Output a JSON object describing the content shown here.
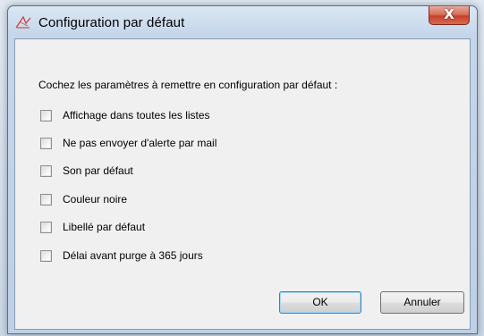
{
  "dialog": {
    "title": "Configuration par défaut",
    "close_label": "X",
    "instruction": "Cochez les paramètres à remettre en configuration par défaut :",
    "options": [
      {
        "label": "Affichage dans toutes les listes",
        "checked": false
      },
      {
        "label": "Ne pas envoyer d'alerte par mail",
        "checked": false
      },
      {
        "label": "Son par défaut",
        "checked": false
      },
      {
        "label": "Couleur noire",
        "checked": false
      },
      {
        "label": "Libellé par défaut",
        "checked": false
      },
      {
        "label": "Délai avant purge à 365 jours",
        "checked": false
      }
    ],
    "ok_label": "OK",
    "cancel_label": "Annuler"
  },
  "icons": {
    "title_icon": "app-logo-icon"
  }
}
